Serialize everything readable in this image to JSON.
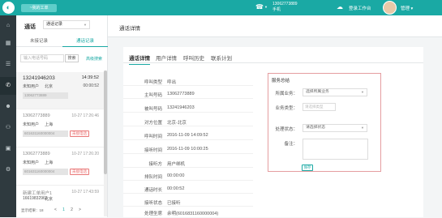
{
  "topbar": {
    "work_button": "~我的工单",
    "phone_number": "13062773889",
    "phone_type": "手机",
    "workbench": "登录工作台",
    "user_name": "管理"
  },
  "listpanel": {
    "title": "通话",
    "select_value": "通话记录",
    "tabs": [
      "未接记录",
      "通话记录"
    ],
    "search_placeholder": "输入电话号码",
    "search_button": "搜索",
    "advanced": "高级搜索",
    "records": [
      {
        "number": "13241946203",
        "time": "14:39:52",
        "sub1": "未知用户",
        "sub2": "北京",
        "duration": "00:00:52",
        "ticket": "13062773889"
      },
      {
        "number": "13062773889",
        "time": "10-27 17:26:46",
        "sub1": "未知用户",
        "sub2": "上海",
        "duration": "",
        "ticket": "601631160000004",
        "badge": "未接电话"
      },
      {
        "number": "13062773889",
        "time": "10-27 17:26:20",
        "sub1": "未知用户",
        "sub2": "上海",
        "duration": "",
        "ticket": "601631160000004",
        "badge": "未接电话"
      },
      {
        "number": "新建工单用户1",
        "time": "10-27 17:43:59",
        "sub1": "16619832963",
        "sub2": "北京",
        "duration": "",
        "ticket": "601631160000004",
        "badge": "未接电话"
      }
    ],
    "pager_count": "显示结果：18",
    "pages": [
      "<",
      "1",
      "2",
      ">"
    ]
  },
  "header": {
    "title": "通话详情"
  },
  "detail": {
    "tabs": [
      "通话详情",
      "用户详情",
      "呼叫历史",
      "联系计划"
    ],
    "fields": [
      {
        "label": "呼叫类型",
        "value": "呼出"
      },
      {
        "label": "主叫号码",
        "value": "13062773889"
      },
      {
        "label": "被叫号码",
        "value": "13241946203"
      },
      {
        "label": "对方位置",
        "value": "北京-北京"
      },
      {
        "label": "呼叫时间",
        "value": "2016-11-09 14:09:52"
      },
      {
        "label": "接听时间",
        "value": "2016-11-09 10:00:25"
      },
      {
        "label": "接听方",
        "value": "用户绑机"
      },
      {
        "label": "排队时间",
        "value": "00:00:00"
      },
      {
        "label": "通话时长",
        "value": "00:00:52"
      },
      {
        "label": "接听状态",
        "value": "已接听"
      },
      {
        "label": "处理坐席",
        "value": "余明(6016831160000004)"
      }
    ]
  },
  "service": {
    "title": "服务总结",
    "category_label": "所属业务：",
    "category_value": "选择所属业务",
    "type_label": "业务类型：",
    "type_placeholder": "请选择类型",
    "status_label": "处理状态：",
    "status_value": "请选择状态",
    "note_label": "备注：",
    "save": "保存"
  }
}
